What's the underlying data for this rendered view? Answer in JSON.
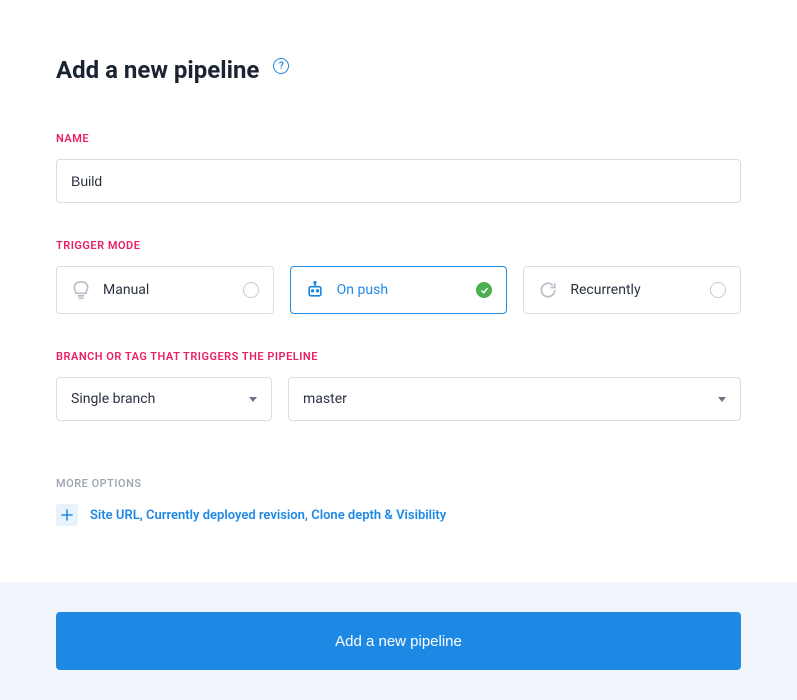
{
  "page": {
    "title": "Add a new pipeline"
  },
  "fields": {
    "name": {
      "label": "NAME",
      "value": "Build"
    },
    "trigger_mode": {
      "label": "TRIGGER MODE",
      "options": {
        "manual": "Manual",
        "on_push": "On push",
        "recurrently": "Recurrently"
      },
      "selected": "on_push"
    },
    "branch": {
      "label": "BRANCH OR TAG THAT TRIGGERS THE PIPELINE",
      "type_value": "Single branch",
      "branch_value": "master"
    }
  },
  "more_options": {
    "label": "MORE OPTIONS",
    "expand_text": "Site URL, Currently deployed revision, Clone depth & Visibility"
  },
  "footer": {
    "submit": "Add a new pipeline"
  }
}
